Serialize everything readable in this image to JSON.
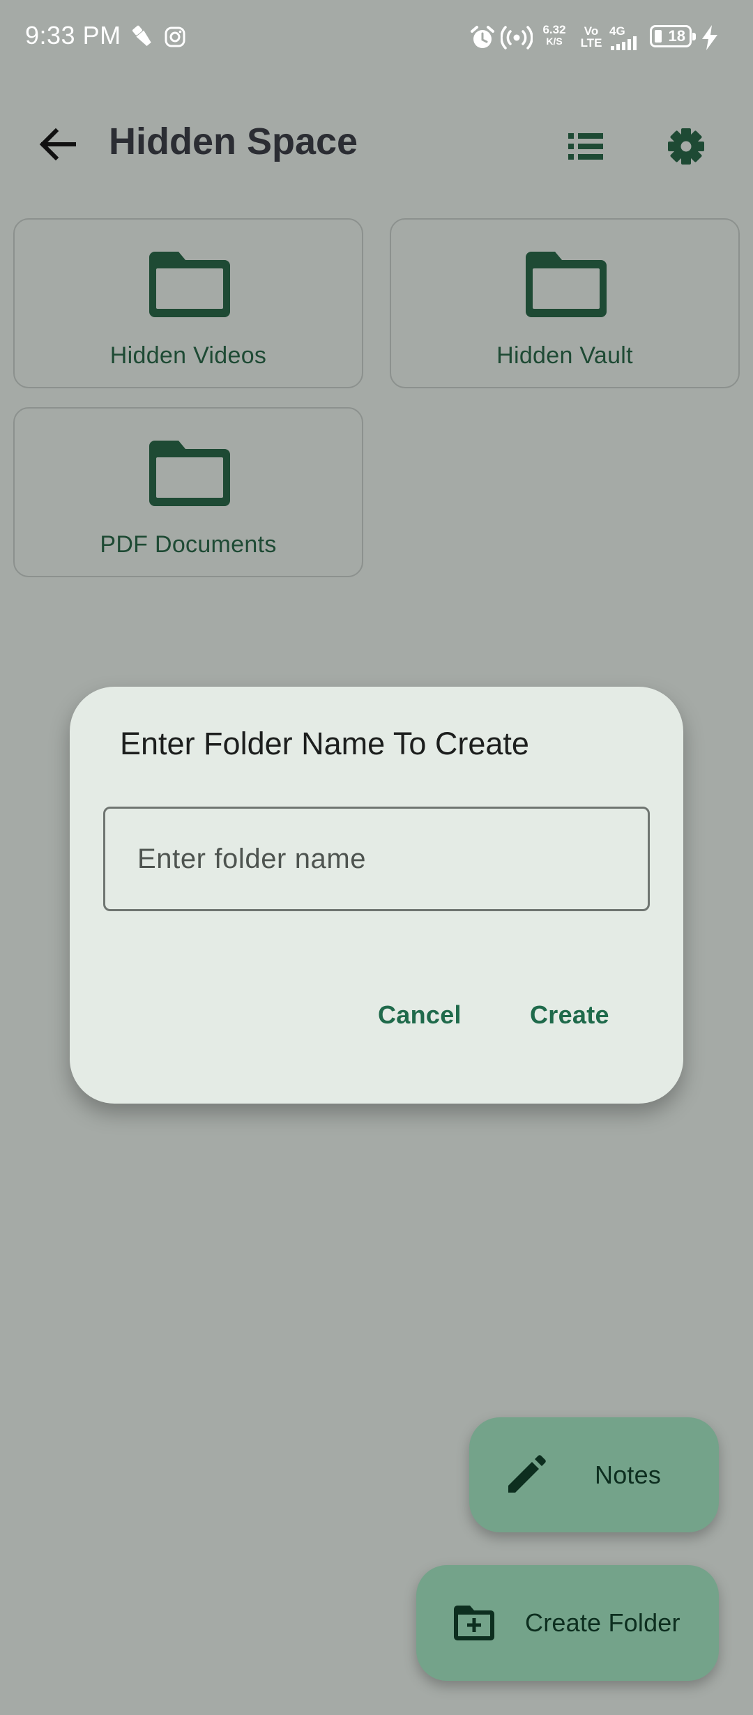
{
  "status_bar": {
    "time": "9:33 PM",
    "data_speed_value": "6.32",
    "data_speed_unit": "K/S",
    "volte_top": "Vo",
    "volte_bottom": "LTE",
    "network": "4G",
    "battery_level": "18",
    "icons": [
      "flashlight-icon",
      "instagram-icon",
      "alarm-icon",
      "hotspot-icon",
      "signal-icon",
      "battery-icon",
      "charging-icon"
    ]
  },
  "appbar": {
    "title": "Hidden Space",
    "icons": [
      "back-arrow-icon",
      "list-view-icon",
      "gear-icon"
    ]
  },
  "folders": [
    {
      "label": "Hidden Videos"
    },
    {
      "label": "Hidden Vault"
    },
    {
      "label": "PDF Documents"
    }
  ],
  "dialog": {
    "title": "Enter Folder Name To Create",
    "input_value": "",
    "input_placeholder": "Enter folder name",
    "cancel_label": "Cancel",
    "create_label": "Create"
  },
  "fabs": {
    "notes_label": "Notes",
    "create_folder_label": "Create Folder"
  },
  "colors": {
    "scrim_background": "#a5aaa6",
    "dialog_surface": "#e4ebe5",
    "accent_green": "#1f6a4b",
    "folder_icon": "#1e4a34",
    "fab_background": "#74a38a"
  }
}
